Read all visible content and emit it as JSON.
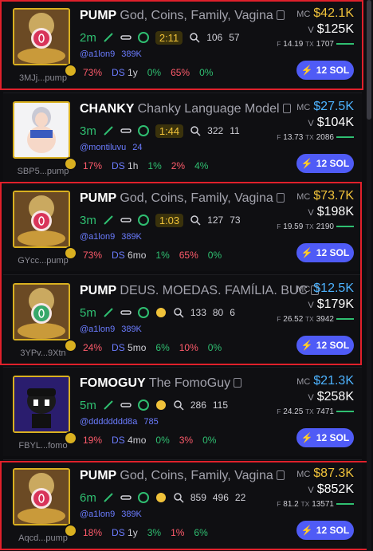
{
  "colors": {
    "highlight": "#e0202b",
    "mc_gold": "#f0c23a",
    "mc_blue": "#4db3ff",
    "accent": "#4f5bf6"
  },
  "cards": [
    {
      "addr": "3MJj...pump",
      "ticker": "PUMP",
      "name": "God, Coins, Family, Vagina",
      "age": "2m",
      "timer": "2:11",
      "holders": "106",
      "pro": "57",
      "handle": "@a1lon9",
      "followers": "389K",
      "pct1": "73%",
      "ds_age": "1y",
      "pct2": "0%",
      "pct3": "65%",
      "pct4": "0%",
      "mc": "$42.1K",
      "vol": "$125K",
      "fee": "14.19",
      "tx": "1707",
      "buy": "12 SOL",
      "image": "gold-coin-art",
      "highlighted": true
    },
    {
      "addr": "SBP5...pump",
      "ticker": "CHANKY",
      "name": "Chanky Language Model",
      "age": "3m",
      "timer": "1:44",
      "holders": "322",
      "pro": "11",
      "handle": "@montiluvu",
      "followers": "24",
      "pct1": "17%",
      "ds_age": "1h",
      "pct2": "1%",
      "pct3": "2%",
      "pct4": "4%",
      "mc": "$27.5K",
      "vol": "$104K",
      "fee": "13.73",
      "tx": "2086",
      "buy": "12 SOL",
      "image": "anime-character",
      "highlighted": false
    },
    {
      "addr": "GYcc...pump",
      "ticker": "PUMP",
      "name": "God, Coins, Family, Vagina",
      "age": "3m",
      "timer": "1:03",
      "holders": "127",
      "pro": "73",
      "handle": "@a1lon9",
      "followers": "389K",
      "pct1": "73%",
      "ds_age": "6mo",
      "pct2": "1%",
      "pct3": "65%",
      "pct4": "0%",
      "mc": "$73.7K",
      "vol": "$198K",
      "fee": "19.59",
      "tx": "2190",
      "buy": "12 SOL",
      "image": "gold-coin-art",
      "highlighted": true
    },
    {
      "addr": "3YPv...9Xtn",
      "ticker": "PUMP",
      "name": "DEUS. MOEDAS. FAMÍLIA. BUC",
      "age": "5m",
      "timer": "",
      "holders": "133",
      "pro": "80",
      "extra": "6",
      "handle": "@a1lon9",
      "followers": "389K",
      "pct1": "24%",
      "ds_age": "5mo",
      "pct2": "6%",
      "pct3": "10%",
      "pct4": "0%",
      "mc": "$12.5K",
      "vol": "$179K",
      "fee": "26.52",
      "tx": "3942",
      "buy": "12 SOL",
      "image": "gold-coin-art-green",
      "highlighted": true
    },
    {
      "addr": "FBYL...fomo",
      "ticker": "FOMOGUY",
      "name": "The FomoGuy",
      "age": "5m",
      "timer": "",
      "holders": "286",
      "pro": "115",
      "handle": "@dddddddd8a",
      "followers": "785",
      "pct1": "19%",
      "ds_age": "4mo",
      "pct2": "0%",
      "pct3": "3%",
      "pct4": "0%",
      "mc": "$21.3K",
      "vol": "$258K",
      "fee": "24.25",
      "tx": "7471",
      "buy": "12 SOL",
      "image": "fomo-avatar",
      "highlighted": false
    },
    {
      "addr": "Aqcd...pump",
      "ticker": "PUMP",
      "name": "God, Coins, Family, Vagina",
      "age": "6m",
      "timer": "",
      "holders": "859",
      "pro": "496",
      "extra": "22",
      "handle": "@a1lon9",
      "followers": "389K",
      "pct1": "18%",
      "ds_age": "1y",
      "pct2": "3%",
      "pct3": "1%",
      "pct4": "6%",
      "mc": "$87.3K",
      "vol": "$852K",
      "fee": "81.2",
      "tx": "13571",
      "buy": "12 SOL",
      "image": "gold-coin-art",
      "highlighted": true
    }
  ],
  "labels": {
    "mc": "MC",
    "v": "V",
    "f": "F",
    "tx": "TX",
    "ds": "DS"
  }
}
